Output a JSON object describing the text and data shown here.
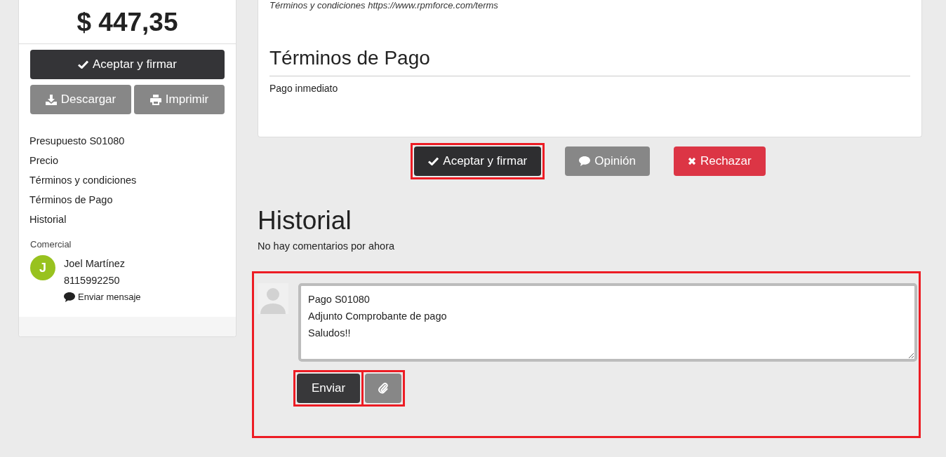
{
  "summary": {
    "price": "$ 447,35",
    "accept_button": "Aceptar y firmar",
    "download_button": "Descargar",
    "print_button": "Imprimir"
  },
  "sidebar": {
    "nav_items": [
      {
        "label": "Presupuesto S01080"
      },
      {
        "label": "Precio"
      },
      {
        "label": "Términos y condiciones"
      },
      {
        "label": "Términos de Pago"
      },
      {
        "label": "Historial"
      }
    ],
    "salesperson": {
      "heading": "Comercial",
      "initial": "J",
      "name": "Joel Martínez",
      "phone": "8115992250",
      "message_link": "Enviar mensaje"
    }
  },
  "document": {
    "terms_line": "Términos y condiciones https://www.rpmforce.com/terms",
    "payment_heading": "Términos de Pago",
    "payment_text": "Pago inmediato"
  },
  "actions": [
    {
      "kind": "accept",
      "label": "Aceptar y firmar",
      "highlighted": true
    },
    {
      "kind": "feedback",
      "label": "Opinión",
      "highlighted": false
    },
    {
      "kind": "reject",
      "label": "Rechazar",
      "highlighted": false
    }
  ],
  "history": {
    "heading": "Historial",
    "empty_text": "No hay comentarios por ahora",
    "highlighted": true,
    "message": "Pago S01080\nAdjunto Comprobante de pago\nSaludos!!",
    "send_button": {
      "label": "Enviar",
      "highlighted": true
    },
    "attach_button": {
      "highlighted": true
    }
  }
}
